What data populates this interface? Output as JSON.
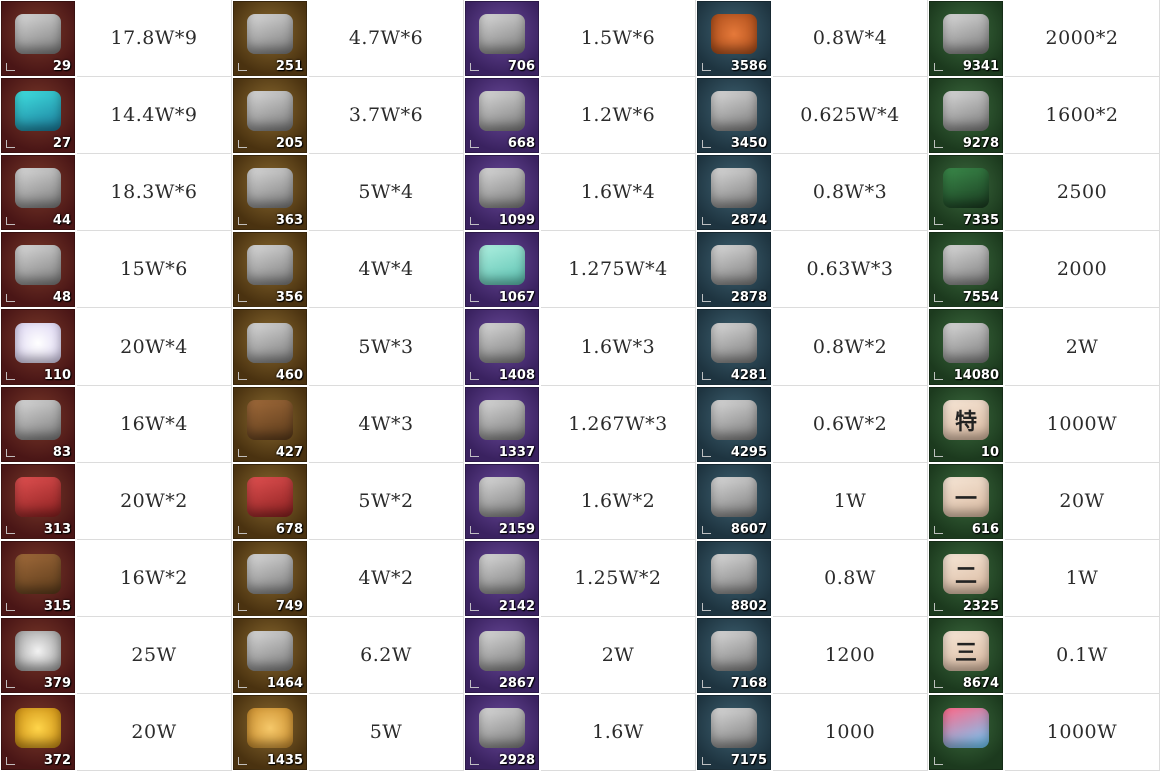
{
  "columns": [
    {
      "bg": "#4a1616",
      "accent": "#7a3a2a",
      "items": [
        {
          "icon": "tv-robot-icon",
          "count": "29",
          "value": "17.8W*9"
        },
        {
          "icon": "sports-car-icon",
          "count": "27",
          "value": "14.4W*9"
        },
        {
          "icon": "goblet-icon",
          "count": "44",
          "value": "18.3W*6"
        },
        {
          "icon": "statue-icon",
          "count": "48",
          "value": "15W*6"
        },
        {
          "icon": "cat-plush-icon",
          "count": "110",
          "value": "20W*4"
        },
        {
          "icon": "drone-icon",
          "count": "83",
          "value": "16W*4"
        },
        {
          "icon": "red-card-icon",
          "count": "313",
          "value": "20W*2"
        },
        {
          "icon": "wood-plank-icon",
          "count": "315",
          "value": "16W*2"
        },
        {
          "icon": "silver-coin-icon",
          "count": "379",
          "value": "25W"
        },
        {
          "icon": "gold-coin-icon",
          "count": "372",
          "value": "20W"
        }
      ]
    },
    {
      "bg": "#4a3210",
      "accent": "#8a6a30",
      "items": [
        {
          "icon": "trousers-icon",
          "count": "251",
          "value": "4.7W*6"
        },
        {
          "icon": "quadcopter-icon",
          "count": "205",
          "value": "3.7W*6"
        },
        {
          "icon": "robot-dog-icon",
          "count": "363",
          "value": "5W*4"
        },
        {
          "icon": "solar-panel-icon",
          "count": "356",
          "value": "4W*4"
        },
        {
          "icon": "rifle-icon",
          "count": "460",
          "value": "5W*3"
        },
        {
          "icon": "board-icon",
          "count": "427",
          "value": "4W*3"
        },
        {
          "icon": "grenade-icon",
          "count": "678",
          "value": "5W*2"
        },
        {
          "icon": "gpu-card-icon",
          "count": "749",
          "value": "4W*2"
        },
        {
          "icon": "helmet-icon",
          "count": "1464",
          "value": "6.2W"
        },
        {
          "icon": "bread-icon",
          "count": "1435",
          "value": "5W"
        }
      ]
    },
    {
      "bg": "#3a2260",
      "accent": "#6a4a9a",
      "items": [
        {
          "icon": "terracotta-figure-icon",
          "count": "706",
          "value": "1.5W*6"
        },
        {
          "icon": "stealth-jet-icon",
          "count": "668",
          "value": "1.2W*6"
        },
        {
          "icon": "hover-drone-icon",
          "count": "1099",
          "value": "1.6W*4"
        },
        {
          "icon": "robot-box-icon",
          "count": "1067",
          "value": "1.275W*4"
        },
        {
          "icon": "staff-icon",
          "count": "1408",
          "value": "1.6W*3"
        },
        {
          "icon": "scroll-painting-icon",
          "count": "1337",
          "value": "1.267W*3"
        },
        {
          "icon": "camera-icon",
          "count": "2159",
          "value": "1.6W*2"
        },
        {
          "icon": "vr-headset-icon",
          "count": "2142",
          "value": "1.25W*2"
        },
        {
          "icon": "video-camera-icon",
          "count": "2867",
          "value": "2W"
        },
        {
          "icon": "figurine-icon",
          "count": "2928",
          "value": "1.6W"
        }
      ]
    },
    {
      "bg": "#1e3440",
      "accent": "#3f6272",
      "items": [
        {
          "icon": "basketball-icon",
          "count": "3586",
          "value": "0.8W*4"
        },
        {
          "icon": "turtle-character-icon",
          "count": "3450",
          "value": "0.625W*4"
        },
        {
          "icon": "flashlight-icon",
          "count": "2874",
          "value": "0.8W*3"
        },
        {
          "icon": "toothbrush-icon",
          "count": "2878",
          "value": "0.63W*3"
        },
        {
          "icon": "goggles-icon",
          "count": "4281",
          "value": "0.8W*2"
        },
        {
          "icon": "mouse-icon",
          "count": "4295",
          "value": "0.6W*2"
        },
        {
          "icon": "hard-drive-icon",
          "count": "8607",
          "value": "1W"
        },
        {
          "icon": "tablet-icon",
          "count": "8802",
          "value": "0.8W"
        },
        {
          "icon": "id-badge-icon",
          "count": "7168",
          "value": "1200"
        },
        {
          "icon": "cigarette-pack-icon",
          "count": "7175",
          "value": "1000"
        }
      ]
    },
    {
      "bg": "#1c3a1e",
      "accent": "#3c6a3e",
      "items": [
        {
          "icon": "fighter-jet-icon",
          "count": "9341",
          "value": "2000*2"
        },
        {
          "icon": "dome-device-icon",
          "count": "9278",
          "value": "1600*2"
        },
        {
          "icon": "medicine-bottle-icon",
          "count": "7335",
          "value": "2500"
        },
        {
          "icon": "bell-icon",
          "count": "7554",
          "value": "2000"
        },
        {
          "icon": "ticket-card-icon",
          "count": "14080",
          "value": "2W"
        },
        {
          "icon": "special-ticket-icon",
          "count": "10",
          "value": "1000W"
        },
        {
          "icon": "ticket-one-icon",
          "count": "616",
          "value": "20W"
        },
        {
          "icon": "ticket-two-icon",
          "count": "2325",
          "value": "1W"
        },
        {
          "icon": "ticket-three-icon",
          "count": "8674",
          "value": "0.1W"
        },
        {
          "icon": "crystal-icon",
          "count": "",
          "value": "1000W"
        }
      ]
    }
  ]
}
